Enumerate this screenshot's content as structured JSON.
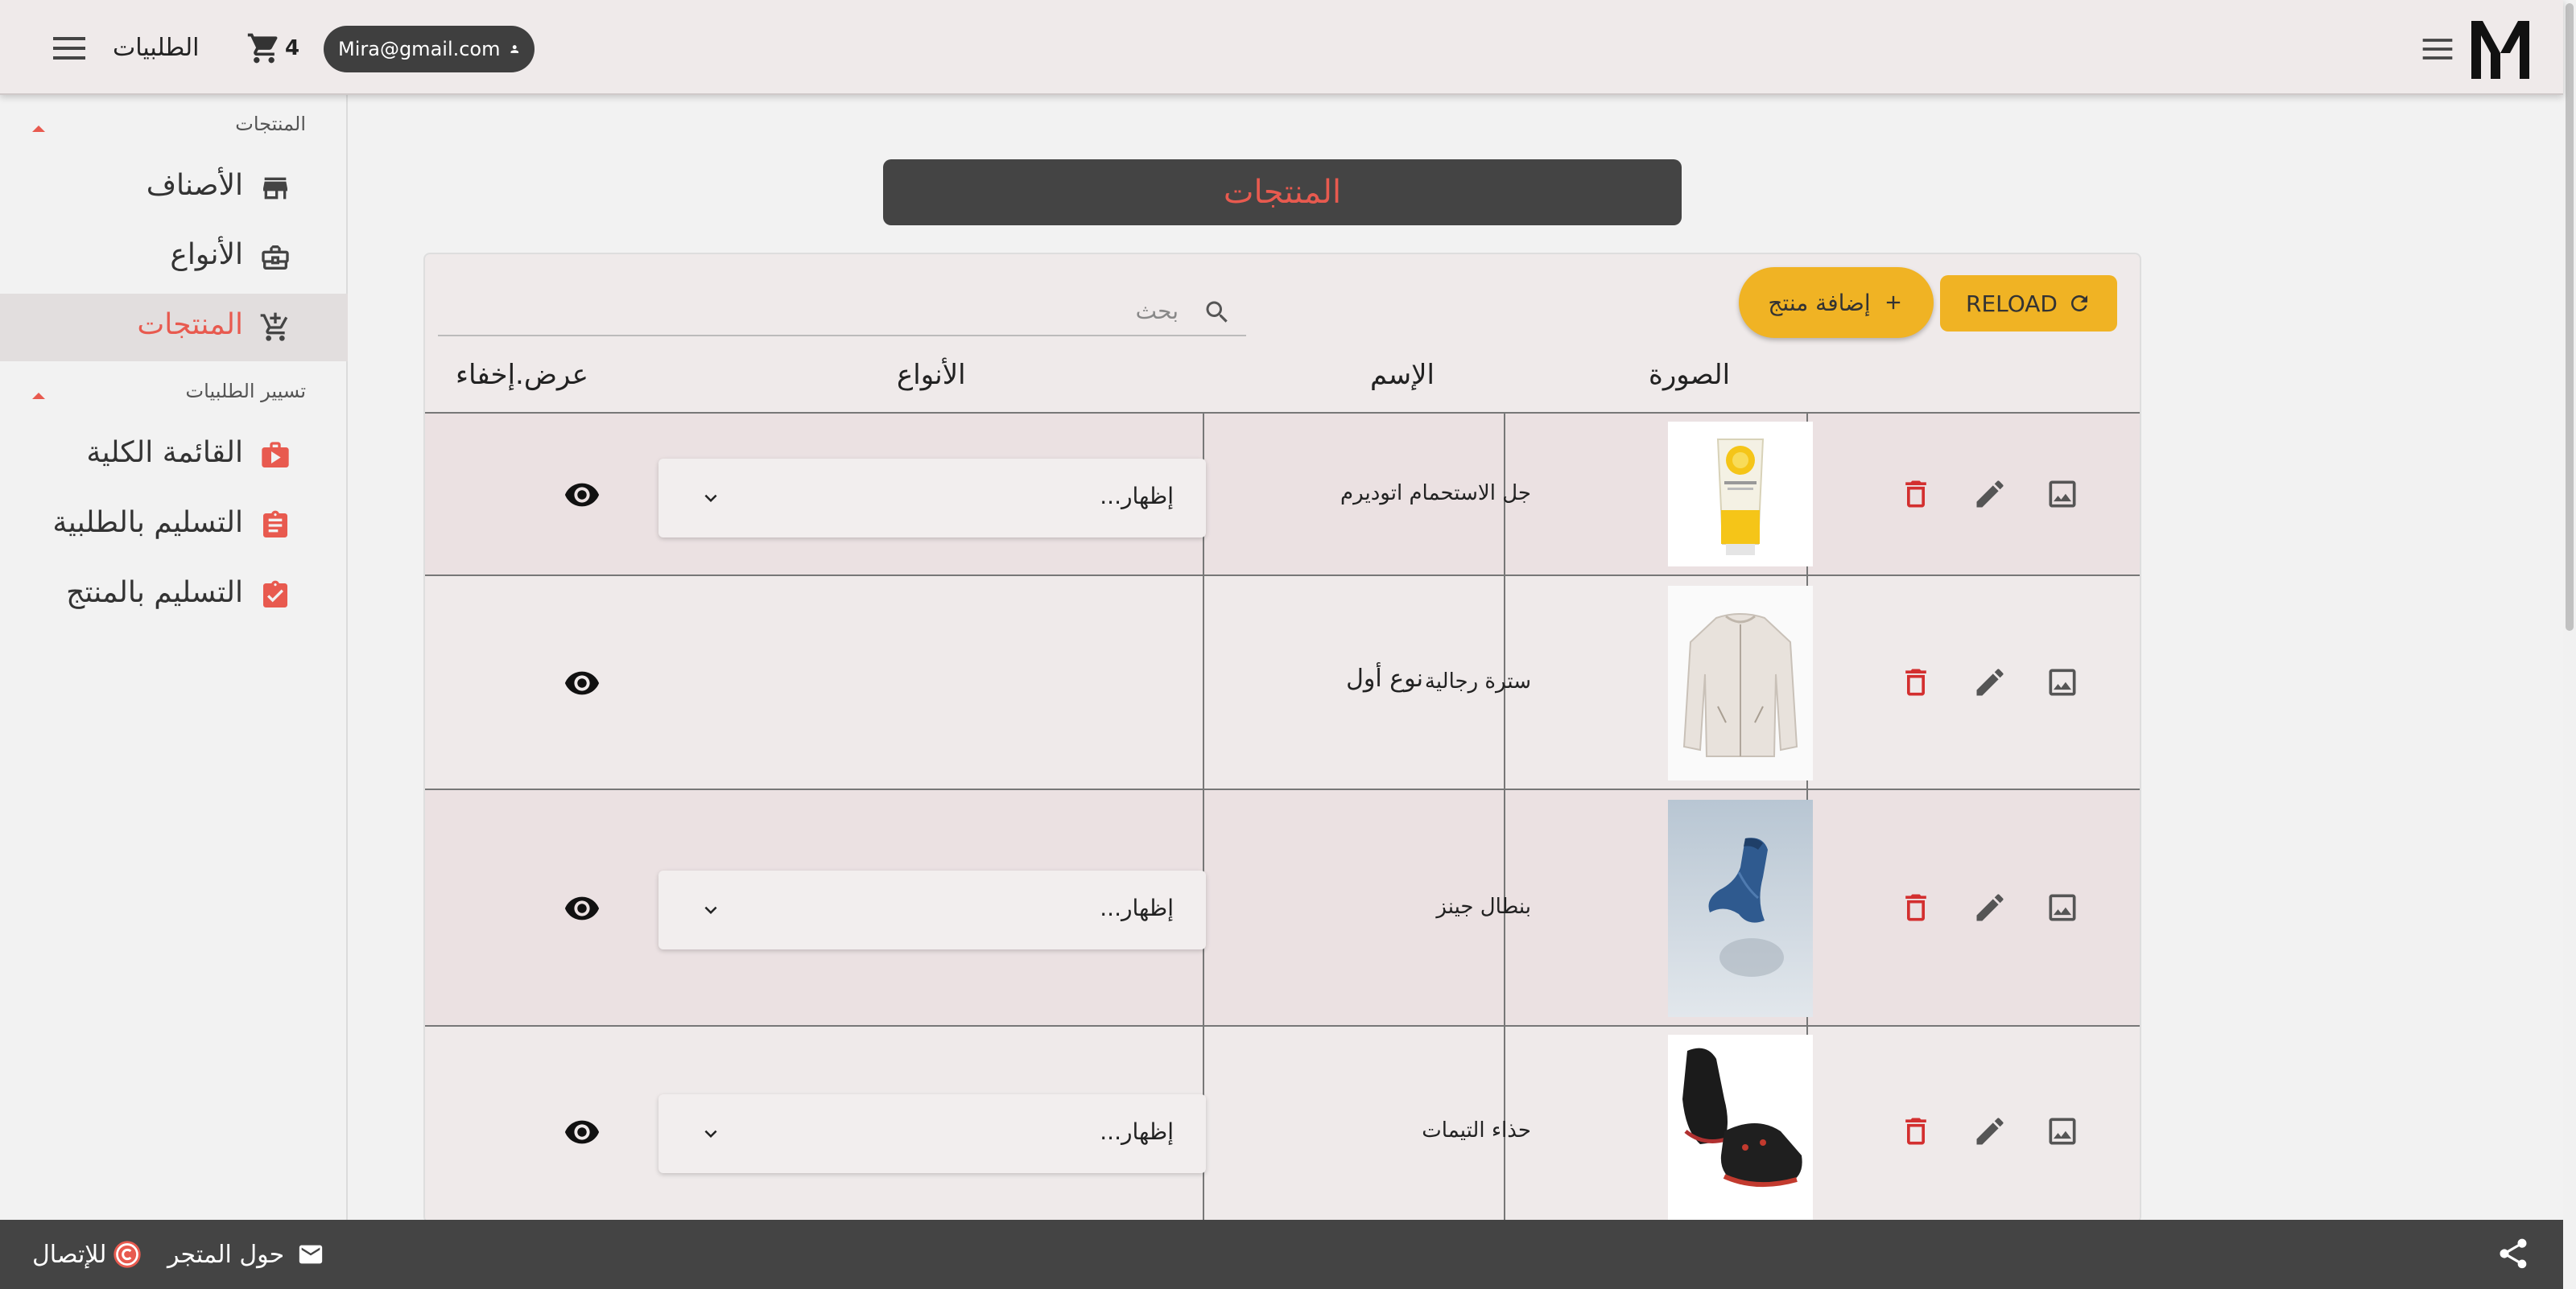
{
  "topbar": {
    "orders_label": "الطلبيات",
    "cart_count": "4",
    "user_email": "Mira@gmail.com"
  },
  "sidebar": {
    "section_products": "المنتجات",
    "section_orders": "تسيير الطلبيات",
    "items": [
      {
        "label": "الأصناف",
        "icon": "store-icon"
      },
      {
        "label": "الأنواع",
        "icon": "briefcase-icon"
      },
      {
        "label": "المنتجات",
        "icon": "cart-add-icon",
        "active": true
      },
      {
        "label": "القائمة الكلية",
        "icon": "shopping-bag-icon"
      },
      {
        "label": "التسليم بالطلبية",
        "icon": "clipboard-list-icon"
      },
      {
        "label": "التسليم بالمنتج",
        "icon": "clipboard-check-icon"
      }
    ]
  },
  "page": {
    "title": "المنتجات"
  },
  "toolbar": {
    "reload_label": "RELOAD",
    "add_label": "إضافة منتج",
    "search_placeholder": "بحث"
  },
  "table": {
    "headers": {
      "image": "الصورة",
      "name": "الإسم",
      "types": "الأنواع",
      "visibility": "عرض.إخفاء"
    },
    "rows": [
      {
        "name": "جل الاستحمام اتوديرم",
        "type_display": "select",
        "type_value": "إظهار..."
      },
      {
        "name": "سترة رجالية",
        "type_display": "text",
        "type_value": "نوع أول"
      },
      {
        "name": "بنطال جينز",
        "type_display": "select",
        "type_value": "إظهار..."
      },
      {
        "name": "حذاء التيمات",
        "type_display": "select",
        "type_value": "إظهار..."
      }
    ]
  },
  "footer": {
    "contact_label": "للإتصال",
    "about_label": "حول المتجر"
  },
  "colors": {
    "accent": "#e85a4f",
    "button": "#f0b324",
    "dark": "#444444",
    "delete": "#d32f2f"
  }
}
